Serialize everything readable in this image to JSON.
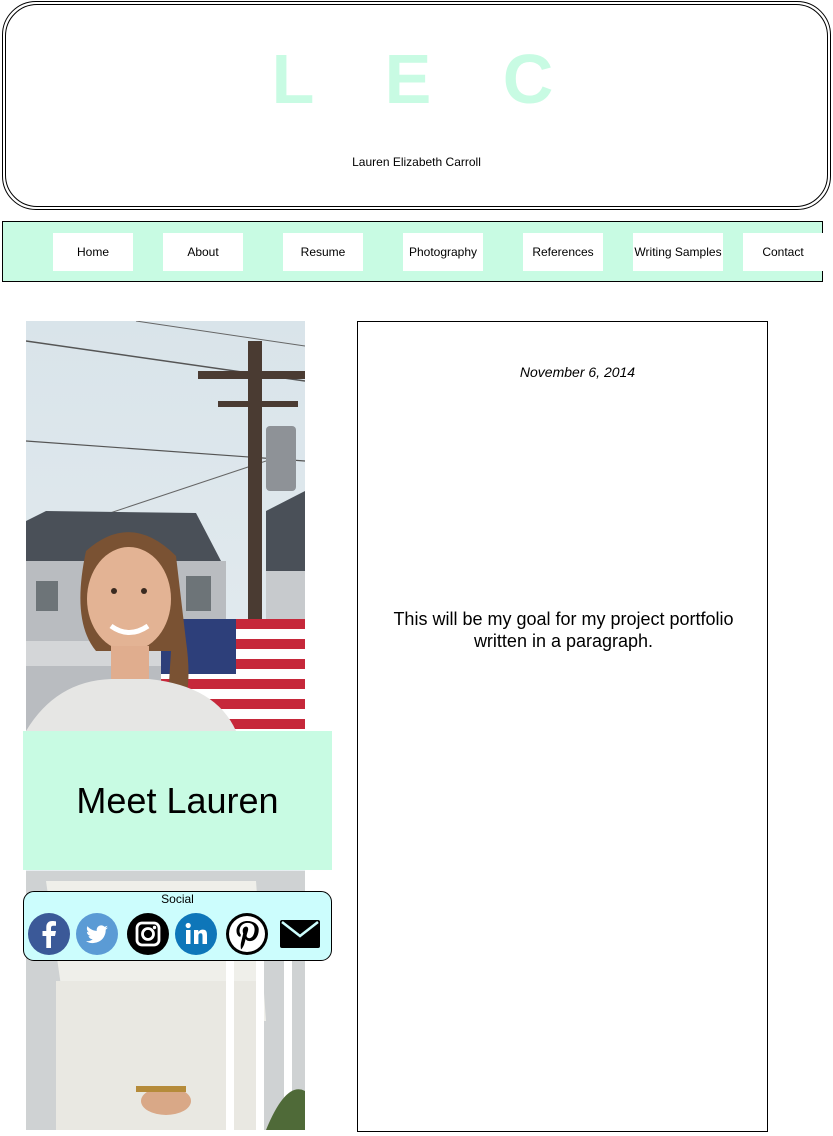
{
  "header": {
    "logo": "L E C",
    "subtitle": "Lauren Elizabeth Carroll"
  },
  "nav": {
    "home": "Home",
    "about": "About",
    "resume": "Resume",
    "photography": "Photography",
    "references": "References",
    "writing": "Writing Samples",
    "contact": "Contact"
  },
  "sidebar": {
    "meet": "Meet Lauren",
    "social_label": "Social",
    "icons": [
      "facebook-icon",
      "twitter-icon",
      "instagram-icon",
      "linkedin-icon",
      "pinterest-icon",
      "email-icon"
    ]
  },
  "content": {
    "date": "November 6, 2014",
    "paragraph": "This will be my goal for my project portfolio written in a paragraph."
  },
  "colors": {
    "accent_mint": "#c8fbe3",
    "social_bg": "#ccfdfd",
    "facebook": "#3b5998",
    "twitter": "#5b9bd5",
    "linkedin": "#0e76b9"
  }
}
